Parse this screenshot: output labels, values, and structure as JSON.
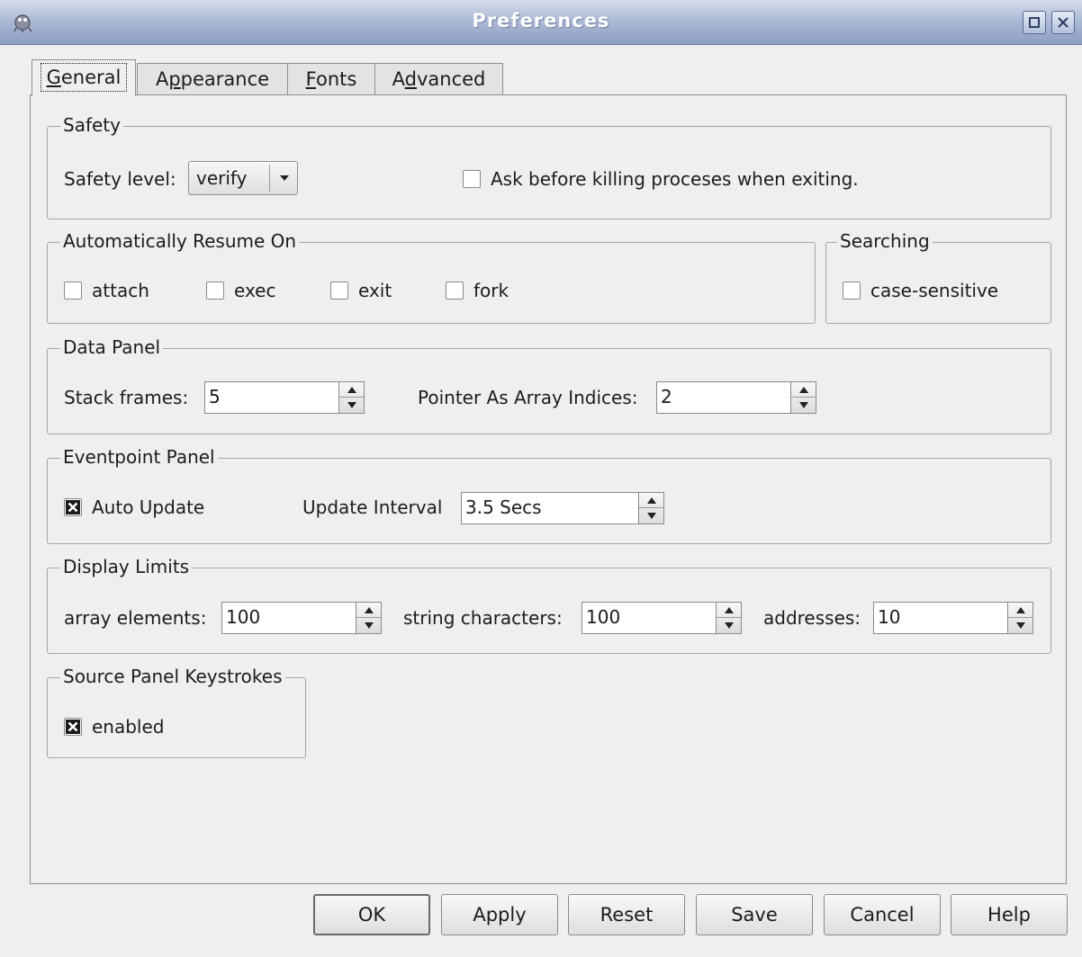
{
  "window": {
    "title": "Preferences"
  },
  "tabs": [
    {
      "pre": "",
      "mnemonic": "G",
      "post": "eneral"
    },
    {
      "pre": "A",
      "mnemonic": "p",
      "post": "pearance"
    },
    {
      "pre": "",
      "mnemonic": "F",
      "post": "onts"
    },
    {
      "pre": "A",
      "mnemonic": "d",
      "post": "vanced"
    }
  ],
  "safety": {
    "title": "Safety",
    "level_label": "Safety level:",
    "level_value": "verify",
    "ask_kill_label": "Ask before killing proceses when exiting.",
    "ask_kill_checked": false
  },
  "resume": {
    "title": "Automatically Resume On",
    "options": [
      {
        "label": "attach",
        "checked": false
      },
      {
        "label": "exec",
        "checked": false
      },
      {
        "label": "exit",
        "checked": false
      },
      {
        "label": "fork",
        "checked": false
      }
    ]
  },
  "searching": {
    "title": "Searching",
    "case_label": "case-sensitive",
    "case_checked": false
  },
  "data_panel": {
    "title": "Data Panel",
    "stack_label": "Stack frames:",
    "stack_value": "5",
    "pointer_label": "Pointer As Array Indices:",
    "pointer_value": "2"
  },
  "eventpoint": {
    "title": "Eventpoint Panel",
    "auto_label": "Auto Update",
    "auto_checked": true,
    "interval_label": "Update Interval",
    "interval_value": "3.5 Secs"
  },
  "limits": {
    "title": "Display Limits",
    "array_label": "array elements:",
    "array_value": "100",
    "string_label": "string characters:",
    "string_value": "100",
    "addr_label": "addresses:",
    "addr_value": "10"
  },
  "keystrokes": {
    "title": "Source Panel Keystrokes",
    "enabled_label": "enabled",
    "enabled_checked": true
  },
  "buttons": {
    "ok": "OK",
    "apply": "Apply",
    "reset": "Reset",
    "save": "Save",
    "cancel": "Cancel",
    "help": "Help"
  },
  "icons": {
    "app": "debugger-app-icon",
    "maximize": "maximize-icon",
    "close": "close-icon",
    "dropdown": "chevron-down-icon",
    "spin_up": "spin-up-icon",
    "spin_down": "spin-down-icon",
    "check": "checkmark-x-icon"
  }
}
